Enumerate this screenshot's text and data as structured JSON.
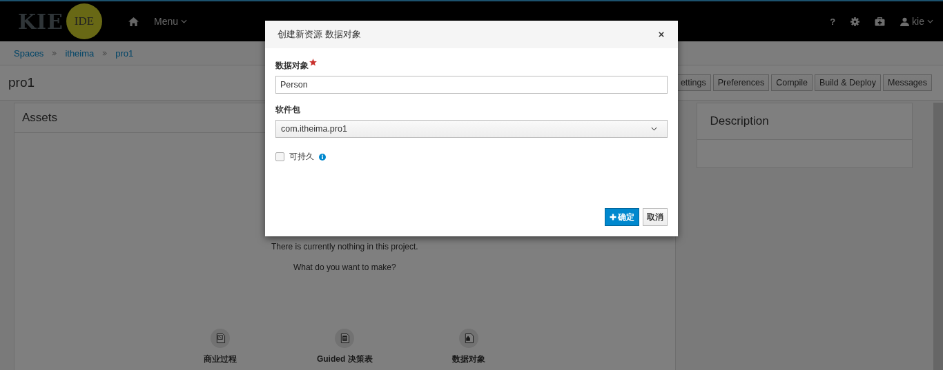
{
  "top_bar": {
    "logo": "KIE",
    "logo_badge": "IDE",
    "menu": "Menu",
    "help": "?",
    "user": "kie"
  },
  "breadcrumb": [
    "Spaces",
    "itheima",
    "pro1"
  ],
  "project": {
    "title": "pro1",
    "buttons": [
      "ettings",
      "Preferences",
      "Compile",
      "Build & Deploy",
      "Messages"
    ]
  },
  "assets_panel": {
    "title": "Assets",
    "empty_message": "There is currently nothing in this project.",
    "prompt": "What do you want to make?",
    "asset_types": [
      {
        "label": "商业过程",
        "kind": "process"
      },
      {
        "label": "Guided 决策表",
        "kind": "decision-table"
      },
      {
        "label": "数据对象",
        "kind": "data-object"
      }
    ]
  },
  "description_panel": {
    "title": "Description"
  },
  "dialog": {
    "title": "创建新资源 数据对象",
    "name_field": {
      "label": "数据对象",
      "required": true,
      "value": "Person"
    },
    "package_field": {
      "label": "软件包",
      "value": "com.itheima.pro1"
    },
    "persistable": {
      "label": "可持久",
      "checked": false
    },
    "ok_button": "确定",
    "cancel_button": "取消"
  }
}
